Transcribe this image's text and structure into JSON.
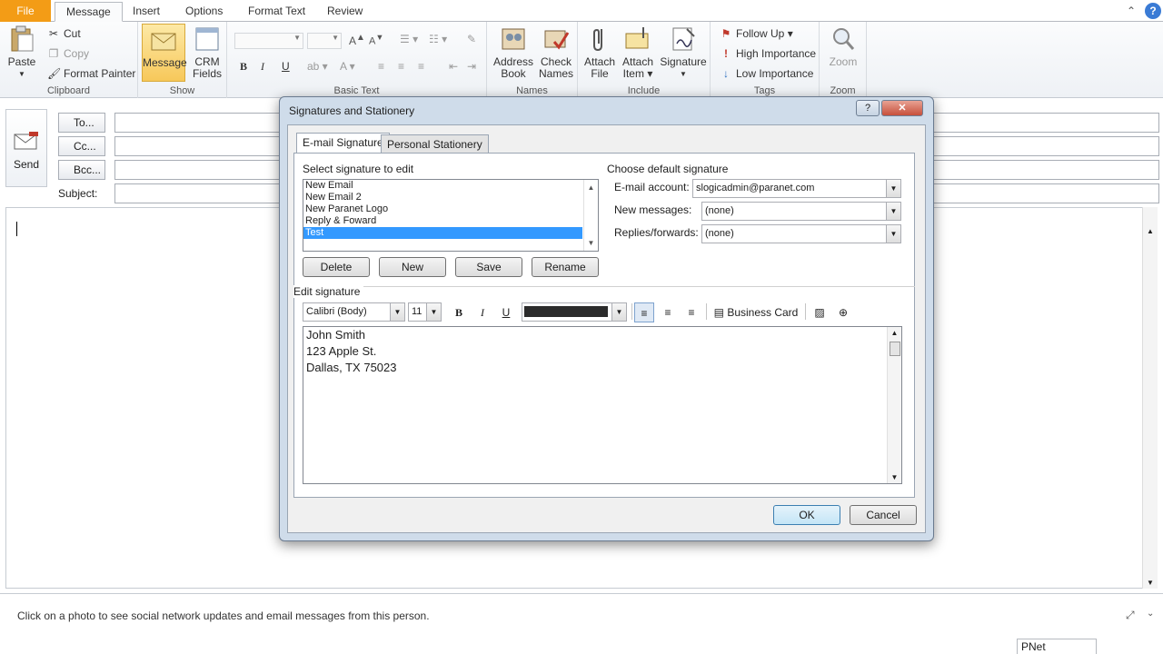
{
  "ribbon": {
    "tabs": [
      "File",
      "Message",
      "Insert",
      "Options",
      "Format Text",
      "Review"
    ],
    "active_tab": "Message",
    "clipboard": {
      "paste": "Paste",
      "cut": "Cut",
      "copy": "Copy",
      "format_painter": "Format Painter",
      "label": "Clipboard"
    },
    "show": {
      "message": "Message",
      "crm": "CRM",
      "fields": "Fields",
      "label": "Show"
    },
    "basic_text": {
      "label": "Basic Text"
    },
    "names": {
      "address": "Address",
      "book": "Book",
      "check": "Check",
      "names_btn": "Names",
      "label": "Names"
    },
    "include": {
      "attach_file": "Attach",
      "file": "File",
      "attach_item": "Attach",
      "item": "Item",
      "signature": "Signature",
      "label": "Include"
    },
    "tags": {
      "follow_up": "Follow Up",
      "high": "High Importance",
      "low": "Low Importance",
      "label": "Tags"
    },
    "zoom": {
      "zoom": "Zoom",
      "label": "Zoom"
    }
  },
  "compose": {
    "send": "Send",
    "to": "To...",
    "cc": "Cc...",
    "bcc": "Bcc...",
    "subject": "Subject:"
  },
  "status": {
    "text": "Click on a photo to see social network updates and email messages from this person.",
    "pnet": "PNet"
  },
  "dialog": {
    "title": "Signatures and Stationery",
    "help": "?",
    "close": "✕",
    "tabs": {
      "email_signature": "E-mail Signature",
      "personal_stationery": "Personal Stationery"
    },
    "select_label": "Select signature to edit",
    "signatures": [
      "New Email",
      "New Email 2",
      "New Paranet Logo",
      "Reply & Foward",
      "Test"
    ],
    "selected_signature": "Test",
    "buttons": {
      "delete": "Delete",
      "new": "New",
      "save": "Save",
      "rename": "Rename",
      "ok": "OK",
      "cancel": "Cancel"
    },
    "default_label": "Choose default signature",
    "email_account_label": "E-mail account:",
    "email_account": "slogicadmin@paranet.com",
    "new_messages_label": "New messages:",
    "new_messages": "(none)",
    "replies_label": "Replies/forwards:",
    "replies": "(none)",
    "edit_label": "Edit signature",
    "font": "Calibri (Body)",
    "size": "11",
    "business_card": "Business Card",
    "signature_lines": [
      "John Smith",
      "123 Apple St.",
      "Dallas, TX 75023"
    ]
  }
}
